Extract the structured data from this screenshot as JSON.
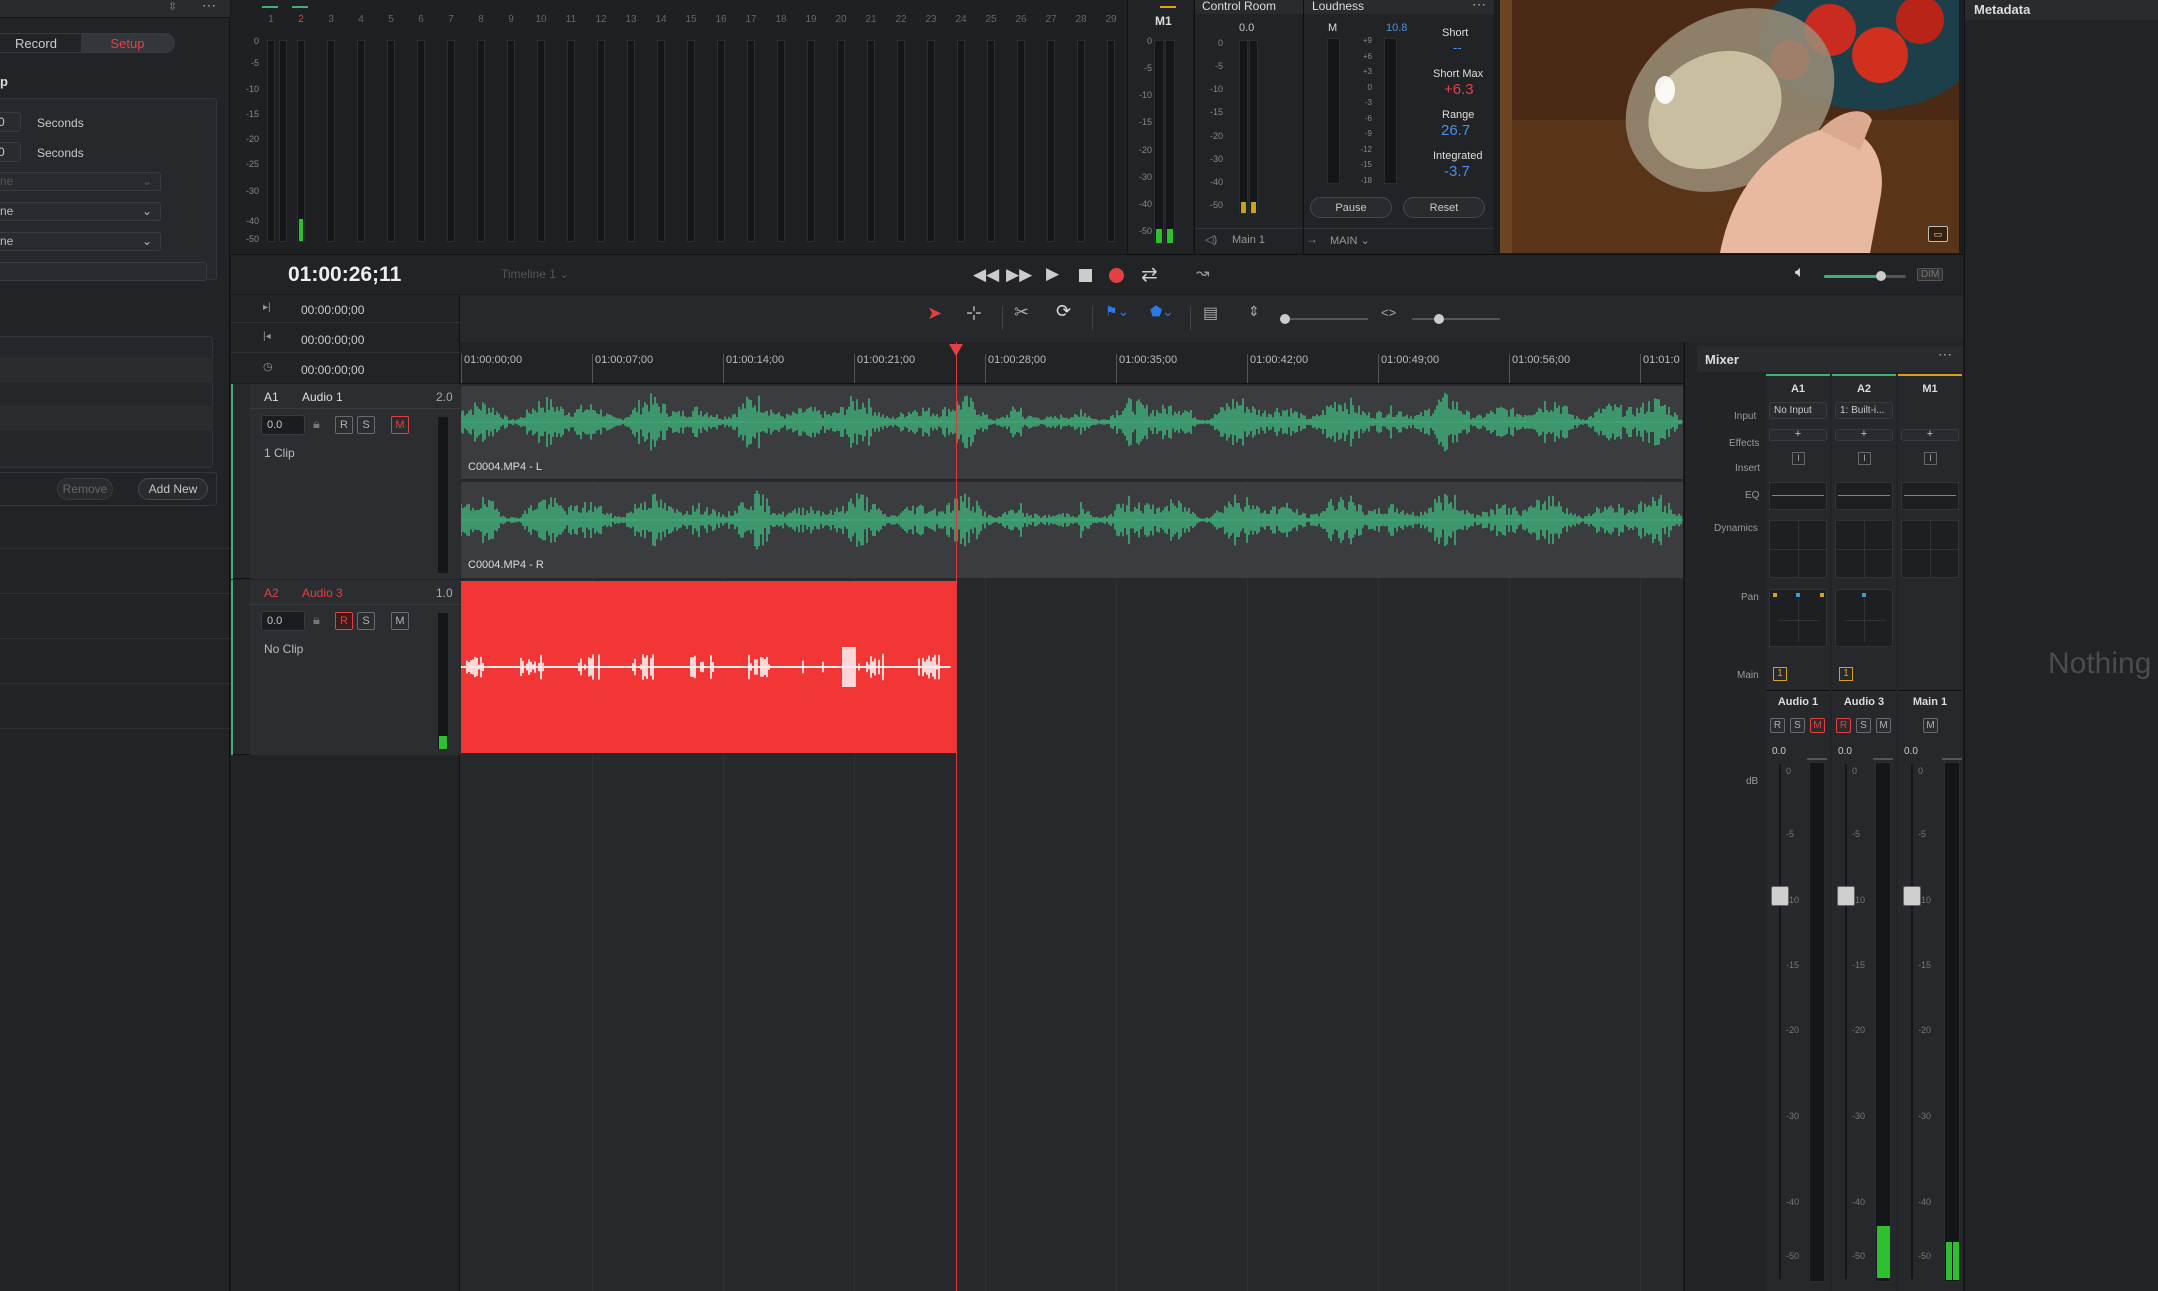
{
  "inspector": {
    "tabs": {
      "record": "Record",
      "setup": "Setup"
    },
    "section_title": "p",
    "field1_value": "0",
    "field1_unit": "Seconds",
    "field2_value": "0",
    "field2_unit": "Seconds",
    "select1": "ne",
    "select2": "ne",
    "select3": "ne",
    "remove_label": "Remove",
    "add_new_label": "Add New"
  },
  "meters": {
    "channel_numbers": [
      "1",
      "2",
      "3",
      "4",
      "5",
      "6",
      "7",
      "8",
      "9",
      "10",
      "11",
      "12",
      "13",
      "14",
      "15",
      "16",
      "17",
      "18",
      "19",
      "20",
      "21",
      "22",
      "23",
      "24",
      "25",
      "26",
      "27",
      "28",
      "29"
    ],
    "active_channel": "2",
    "scale": [
      "0",
      "-5",
      "-10",
      "-15",
      "-20",
      "-25",
      "-30",
      "-40",
      "-50"
    ],
    "main_label": "M1",
    "main_scale": [
      "0",
      "-5",
      "-10",
      "-15",
      "-20",
      "-30",
      "-40",
      "-50"
    ]
  },
  "control_room": {
    "title": "Control Room",
    "value": "0.0",
    "scale": [
      "0",
      "-5",
      "-10",
      "-15",
      "-20",
      "-30",
      "-40",
      "-50"
    ],
    "output": "Main 1",
    "bus": "MAIN"
  },
  "loudness": {
    "title": "Loudness",
    "m_label": "M",
    "m_value": "10.8",
    "scale": [
      "+9",
      "+6",
      "+3",
      "0",
      "-3",
      "-6",
      "-9",
      "-12",
      "-15",
      "-18"
    ],
    "short_label": "Short",
    "short_value": "--",
    "short_max_label": "Short Max",
    "short_max_value": "+6.3",
    "range_label": "Range",
    "range_value": "26.7",
    "integrated_label": "Integrated",
    "integrated_value": "-3.7",
    "pause_label": "Pause",
    "reset_label": "Reset"
  },
  "metadata": {
    "title": "Metadata",
    "empty_text": "Nothing"
  },
  "transport": {
    "timecode": "01:00:26;11",
    "timeline_name": "Timeline 1",
    "in_tc": "00:00:00;00",
    "out_tc": "00:00:00;00",
    "dur_tc": "00:00:00;00",
    "volume_fraction": 0.7,
    "dim_label": "DIM"
  },
  "ruler": {
    "ticks": [
      "01:00:00;00",
      "01:00:07;00",
      "01:00:14;00",
      "01:00:21;00",
      "01:00:28;00",
      "01:00:35;00",
      "01:00:42;00",
      "01:00:49;00",
      "01:00:56;00",
      "01:01:0"
    ]
  },
  "tracks": [
    {
      "id": "A1",
      "name": "Audio 1",
      "format": "2.0",
      "volume": "0.0",
      "clip_info": "1 Clip",
      "clip_l": "C0004.MP4 - L",
      "clip_r": "C0004.MP4 - R"
    },
    {
      "id": "A2",
      "name": "Audio 3",
      "format": "1.0",
      "volume": "0.0",
      "clip_info": "No Clip"
    }
  ],
  "mixer": {
    "title": "Mixer",
    "channels": [
      "A1",
      "A2",
      "M1"
    ],
    "row_labels": {
      "input": "Input",
      "effects": "Effects",
      "insert": "Insert",
      "eq": "EQ",
      "dynamics": "Dynamics",
      "pan": "Pan",
      "main": "Main",
      "db": "dB"
    },
    "inputs": [
      "No Input",
      "1: Built-i..."
    ],
    "main_assign": [
      "1",
      "1"
    ],
    "names": [
      "Audio 1",
      "Audio 3",
      "Main 1"
    ],
    "fader_values": [
      "0.0",
      "0.0",
      "0.0"
    ],
    "scale": [
      "0",
      "-5",
      "-10",
      "-15",
      "-20",
      "-30",
      "-40",
      "-50"
    ]
  },
  "colors": {
    "accent_red": "#e34141",
    "waveform_green": "#3fae77",
    "record_clip": "#f23535",
    "playhead": "#d93a3a",
    "loud_blue": "#4a90e2"
  }
}
